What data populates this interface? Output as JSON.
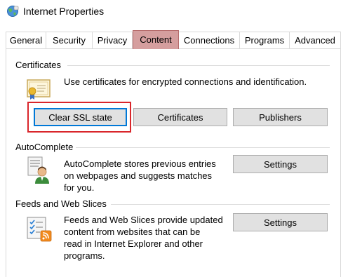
{
  "window": {
    "title": "Internet Properties",
    "icon": "internet-options-globe-icon"
  },
  "tabs": [
    {
      "label": "General"
    },
    {
      "label": "Security"
    },
    {
      "label": "Privacy"
    },
    {
      "label": "Content",
      "active": true
    },
    {
      "label": "Connections"
    },
    {
      "label": "Programs"
    },
    {
      "label": "Advanced"
    }
  ],
  "certificates": {
    "title": "Certificates",
    "description": "Use certificates for encrypted connections and identification.",
    "icon": "certificate-icon",
    "buttons": {
      "clear_ssl": "Clear SSL state",
      "certificates": "Certificates",
      "publishers": "Publishers"
    },
    "highlight_color": "#d9262b"
  },
  "autocomplete": {
    "title": "AutoComplete",
    "description_lines": [
      "AutoComplete stores previous entries",
      "on webpages and suggests matches",
      "for you."
    ],
    "icon": "autocomplete-user-icon",
    "settings_label": "Settings"
  },
  "feeds": {
    "title": "Feeds and Web Slices",
    "description_lines": [
      "Feeds and Web Slices provide updated",
      "content from websites that can be",
      "read in Internet Explorer and other",
      "programs."
    ],
    "icon": "feed-list-icon",
    "settings_label": "Settings"
  },
  "colors": {
    "active_tab": "#d59e9e",
    "button_face": "#e1e1e1",
    "focus_border": "#0078d7"
  }
}
